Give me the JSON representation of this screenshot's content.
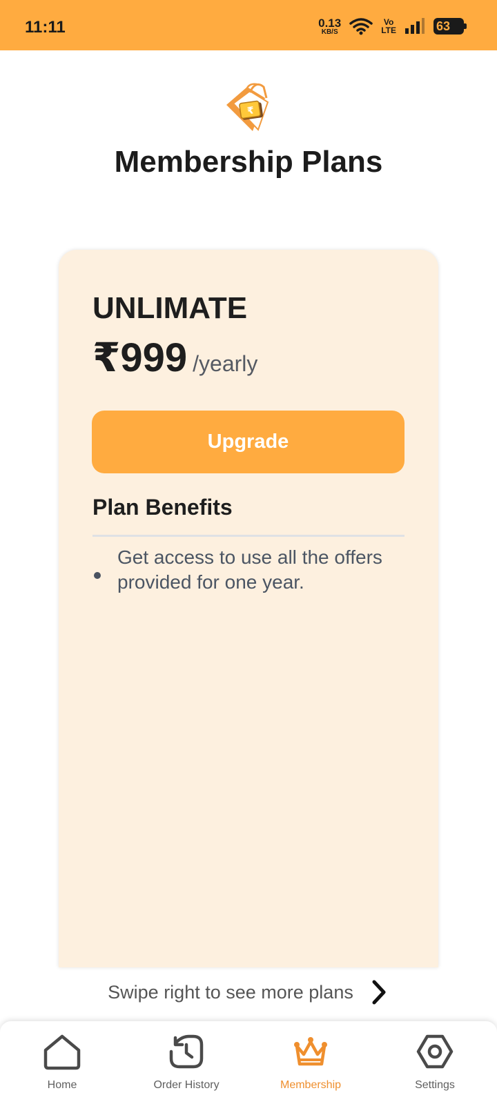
{
  "status_bar": {
    "time": "11:11",
    "net_speed_value": "0.13",
    "net_speed_unit": "KB/S",
    "volte_top": "Vo",
    "volte_bottom": "LTE",
    "battery": "63"
  },
  "header": {
    "title": "Membership Plans"
  },
  "plan": {
    "name": "UNLIMATE",
    "price": "₹999",
    "period": "/yearly",
    "upgrade_label": "Upgrade",
    "benefits_heading": "Plan Benefits",
    "benefits": [
      "Get access to use all the offers provided for one year."
    ]
  },
  "swipe_hint": "Swipe right to see more plans",
  "bottom_nav": {
    "items": [
      {
        "label": "Home",
        "icon": "home-icon"
      },
      {
        "label": "Order History",
        "icon": "history-icon"
      },
      {
        "label": "Membership",
        "icon": "crown-icon",
        "active": true
      },
      {
        "label": "Settings",
        "icon": "settings-icon"
      }
    ]
  },
  "colors": {
    "accent": "#ffab40",
    "card_background": "#fdf0df",
    "active_nav": "#ef8f2e"
  }
}
